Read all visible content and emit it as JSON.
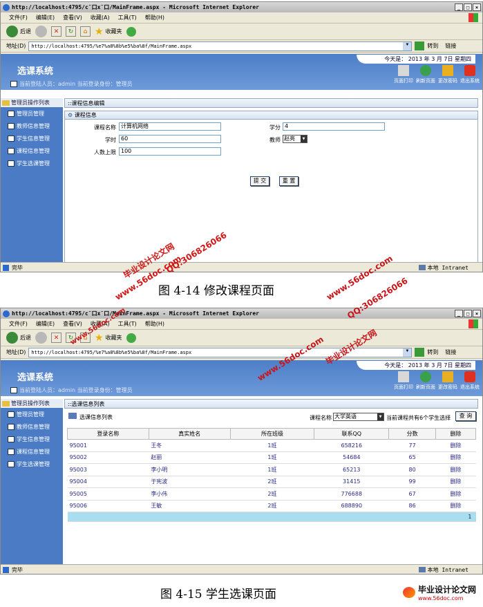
{
  "browser": {
    "title": "http://localhost:4795/c˜口x˜口/MainFrame.aspx - Microsoft Internet Explorer",
    "menu": [
      "文件(F)",
      "编辑(E)",
      "查看(V)",
      "收藏(A)",
      "工具(T)",
      "帮助(H)"
    ],
    "back_label": "后退",
    "favorites_label": "收藏夹",
    "address_label": "地址(D)",
    "url": "http://localhost:4795/%e7%a8%8b%e5%ba%8f/MainFrame.aspx",
    "go_label": "转到",
    "links_label": "链接",
    "status_done": "完毕",
    "zone": "本地 Intranet"
  },
  "app": {
    "title": "选课系统",
    "today": "今天是： 2013 年 3 月 7日 星期四",
    "user_info": "当前登陆人员：admin 当前登录身份：管理员",
    "header_actions": [
      "页面打印",
      "刷新页面",
      "更改密码",
      "退出系统"
    ],
    "sidebar_head": "管理员操作列表",
    "sidebar_items": [
      "管理员管理",
      "教师信息管理",
      "学生信息管理",
      "课程信息管理",
      "学生选课管理"
    ]
  },
  "fig1": {
    "section_bar": "课程信息编辑",
    "sub_bar": "课程信息",
    "course_name_label": "课程名称",
    "course_name_value": "计算机网络",
    "credit_label": "学分",
    "credit_value": "4",
    "hours_label": "学时",
    "hours_value": "60",
    "teacher_label": "教师",
    "teacher_value": "赵亮",
    "limit_label": "人数上限",
    "limit_value": "100",
    "submit_label": "提 交",
    "reset_label": "重 置",
    "caption": "图 4-14  修改课程页面"
  },
  "fig2": {
    "section_bar": "选课信息列表",
    "list_title": "选课信息列表",
    "course_label": "课程名称",
    "course_value": "大学英语",
    "count_text": "当前课程共有6个学生选择",
    "query_label": "查 询",
    "columns": [
      "登录名称",
      "真实姓名",
      "所在班级",
      "联系QQ",
      "分数",
      "删除"
    ],
    "rows": [
      [
        "95001",
        "王冬",
        "1班",
        "658216",
        "77",
        "删除"
      ],
      [
        "95002",
        "赵丽",
        "1班",
        "54684",
        "65",
        "删除"
      ],
      [
        "95003",
        "李小明",
        "1班",
        "65213",
        "80",
        "删除"
      ],
      [
        "95004",
        "于宪波",
        "2班",
        "31415",
        "99",
        "删除"
      ],
      [
        "95005",
        "李小伟",
        "2班",
        "776688",
        "67",
        "删除"
      ],
      [
        "95006",
        "王敏",
        "2班",
        "688890",
        "86",
        "删除"
      ]
    ],
    "pager": "1",
    "caption": "图 4-15 学生选课页面"
  },
  "watermarks": {
    "site_cn": "毕业设计论文网",
    "site_url": "www.56doc.com",
    "qq": "QQ:306826066"
  },
  "bottom_logo": {
    "name": "毕业设计论文网",
    "url": "www.56doc.com"
  },
  "colors": {
    "header_blue": "#4d7ec8",
    "sidebar_blue": "#4a7bc4",
    "watermark_red": "#d01818",
    "pager_bg": "#a8def0"
  }
}
